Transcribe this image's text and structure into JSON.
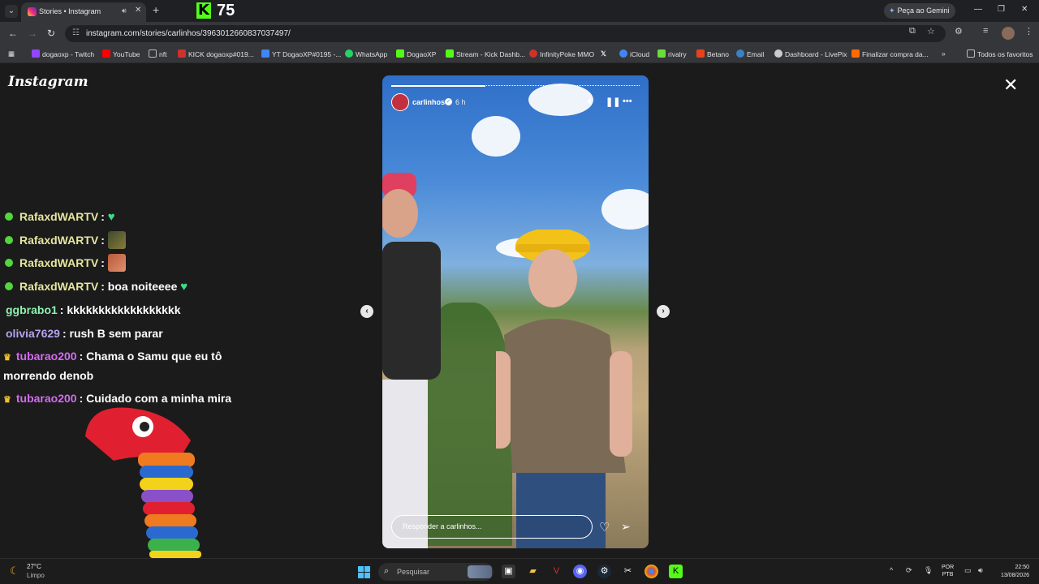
{
  "browser": {
    "tab": {
      "title": "Stories • Instagram"
    },
    "kick_badge": {
      "count": "75"
    },
    "gemini_button": "Peça ao Gemini",
    "address": {
      "url": "instagram.com/stories/carlinhos/3963012660837037497/"
    },
    "bookmarks": [
      {
        "label": "dogaoxp - Twitch",
        "color": "#9146ff"
      },
      {
        "label": "YouTube",
        "color": "#ff0000"
      },
      {
        "label": "nft",
        "color": "#888888"
      },
      {
        "label": "KICK dogaoxp#019...",
        "color": "#d0312d"
      },
      {
        "label": "YT DogaoXP#0195 -...",
        "color": "#4285f4"
      },
      {
        "label": "WhatsApp",
        "color": "#25d366"
      },
      {
        "label": "DogaoXP",
        "color": "#53fc18"
      },
      {
        "label": "Stream - Kick Dashb...",
        "color": "#53fc18"
      },
      {
        "label": "InfinityPoke MMO",
        "color": "#d0312d"
      },
      {
        "label": "",
        "color": "#ffffff"
      },
      {
        "label": "iCloud",
        "color": "#4285f4"
      },
      {
        "label": "rivalry",
        "color": "#6cdc3c"
      },
      {
        "label": "Betano",
        "color": "#e8421a"
      },
      {
        "label": "Email",
        "color": "#3b82c4"
      },
      {
        "label": "Dashboard - LivePix",
        "color": "#cccccc"
      },
      {
        "label": "Finalizar compra da...",
        "color": "#ff6a00"
      }
    ],
    "all_bookmarks": "Todos os favoritos"
  },
  "instagram": {
    "logo": "Instagram",
    "story": {
      "username": "carlinhos",
      "time": "6 h",
      "progress": 0.38,
      "reply_placeholder": "Responder a carlinhos..."
    }
  },
  "chat": [
    {
      "user": "RafaxdWARTV",
      "text": "",
      "user_color": "#e6e6a0",
      "badge": "verified",
      "extra": "heart"
    },
    {
      "user": "RafaxdWARTV",
      "text": "",
      "user_color": "#e6e6a0",
      "badge": "verified",
      "extra": "emote-1"
    },
    {
      "user": "RafaxdWARTV",
      "text": "",
      "user_color": "#e6e6a0",
      "badge": "verified",
      "extra": "emote-2"
    },
    {
      "user": "RafaxdWARTV",
      "text": "boa noiteeee",
      "user_color": "#e6e6a0",
      "badge": "verified",
      "extra": "heart"
    },
    {
      "user": "ggbrabo1",
      "text": "kkkkkkkkkkkkkkkkkk",
      "user_color": "#8ef0b0",
      "badge": "",
      "extra": ""
    },
    {
      "user": "olivia7629",
      "text": "rush B sem parar",
      "user_color": "#b6a4f0",
      "badge": "",
      "extra": ""
    },
    {
      "user": "tubarao200",
      "text": "Chama o Samu que eu tô",
      "text_line2": "morrendo denob",
      "user_color": "#d46cf0",
      "badge": "crown",
      "extra": ""
    },
    {
      "user": "tubarao200",
      "text": "Cuidado com a minha mira",
      "user_color": "#d46cf0",
      "badge": "crown",
      "extra": ""
    }
  ],
  "taskbar": {
    "weather": {
      "temp": "27°C",
      "desc": "Limpo"
    },
    "search_placeholder": "Pesquisar",
    "lang": {
      "line1": "POR",
      "line2": "PTB"
    },
    "clock": {
      "time": "22:50",
      "date": "13/08/2026"
    }
  }
}
